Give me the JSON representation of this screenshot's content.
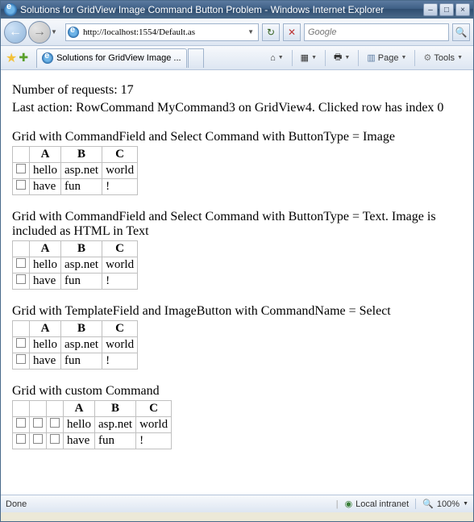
{
  "window": {
    "title": "Solutions for GridView Image Command Button Problem - Windows Internet Explorer",
    "minimize": "–",
    "maximize": "□",
    "close": "×"
  },
  "nav": {
    "back": "←",
    "forward": "→",
    "url": "http://localhost:1554/Default.as",
    "refresh": "↻",
    "stop": "✕",
    "search_placeholder": "Google",
    "search_go": "🔍"
  },
  "tab": {
    "label": "Solutions for GridView Image ..."
  },
  "toolbar": {
    "home": "⌂",
    "feeds": "▦",
    "print": "🖶",
    "page_label": "Page",
    "tools_label": "Tools"
  },
  "content": {
    "requests_label": "Number of requests: 17",
    "last_action": "Last action: RowCommand MyCommand3 on GridView4. Clicked row has index 0",
    "grids": [
      {
        "title": "Grid with CommandField and Select Command with ButtonType = Image",
        "cmd_cols": 1,
        "headers": [
          "A",
          "B",
          "C"
        ],
        "rows": [
          [
            "hello",
            "asp.net",
            "world"
          ],
          [
            "have",
            "fun",
            "!"
          ]
        ]
      },
      {
        "title": "Grid with CommandField and Select Command with ButtonType = Text. Image is included as HTML in Text",
        "cmd_cols": 1,
        "headers": [
          "A",
          "B",
          "C"
        ],
        "rows": [
          [
            "hello",
            "asp.net",
            "world"
          ],
          [
            "have",
            "fun",
            "!"
          ]
        ]
      },
      {
        "title": "Grid with TemplateField and ImageButton with CommandName = Select",
        "cmd_cols": 1,
        "headers": [
          "A",
          "B",
          "C"
        ],
        "rows": [
          [
            "hello",
            "asp.net",
            "world"
          ],
          [
            "have",
            "fun",
            "!"
          ]
        ]
      },
      {
        "title": "Grid with custom Command",
        "cmd_cols": 3,
        "headers": [
          "A",
          "B",
          "C"
        ],
        "rows": [
          [
            "hello",
            "asp.net",
            "world"
          ],
          [
            "have",
            "fun",
            "!"
          ]
        ]
      }
    ]
  },
  "status": {
    "text": "Done",
    "zone": "Local intranet",
    "zoom": "100%"
  }
}
